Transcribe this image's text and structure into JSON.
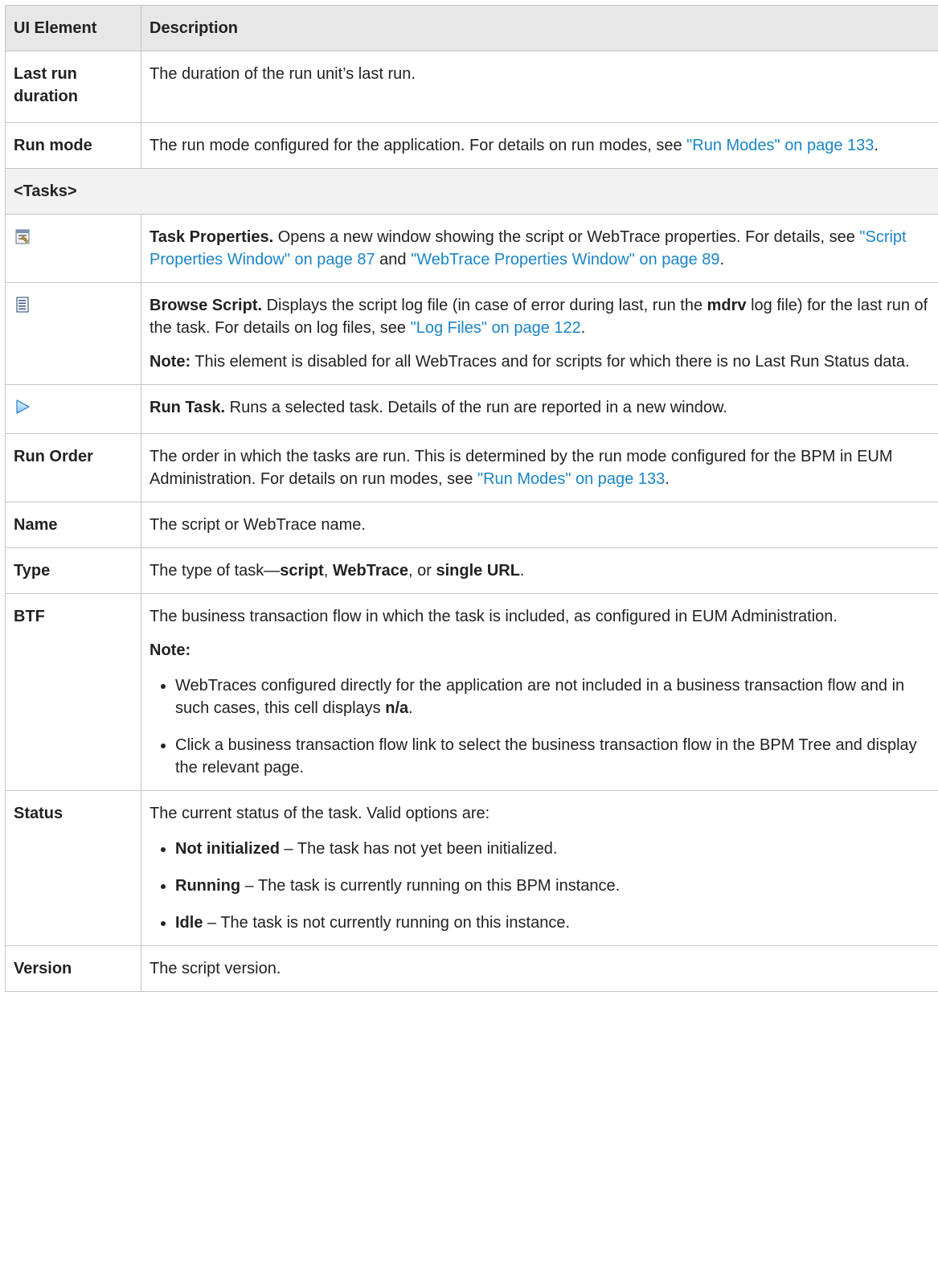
{
  "header": {
    "col1": "UI Element",
    "col2": "Description"
  },
  "rows": {
    "last_run": {
      "label": "Last run duration",
      "desc": "The duration of the run unit’s last run."
    },
    "run_mode": {
      "label": "Run mode",
      "desc_pre": "The run mode configured for the application. For details on run modes, see ",
      "link": "\"Run Modes\" on page 133",
      "desc_post": "."
    },
    "tasks_section": {
      "label": "<Tasks>"
    },
    "task_props": {
      "icon": "task-properties-icon",
      "title": "Task Properties.",
      "desc_pre": " Opens a new window showing the script or WebTrace properties. For details, see ",
      "link1": "\"Script Properties Window\" on page 87",
      "mid": " and ",
      "link2": "\"WebTrace Properties Window\" on page 89",
      "desc_post": "."
    },
    "browse_script": {
      "icon": "browse-script-icon",
      "title": "Browse Script.",
      "desc_pre": " Displays the script log file (in case of error during last, run the ",
      "bold": "mdrv",
      "desc_mid": " log file) for the last run of the task. For details on log files, see ",
      "link": "\"Log Files\" on page 122",
      "desc_post": ".",
      "note_label": "Note:",
      "note_text": " This element is disabled for all WebTraces and for scripts for which there is no Last Run Status data."
    },
    "run_task": {
      "icon": "run-task-icon",
      "title": "Run Task.",
      "desc": " Runs a selected task. Details of the run are reported in a new window."
    },
    "run_order": {
      "label": "Run Order",
      "desc_pre": "The order in which the tasks are run. This is determined by the run mode configured for the BPM in EUM Administration. For details on run modes, see ",
      "link": "\"Run Modes\" on page 133",
      "desc_post": "."
    },
    "name": {
      "label": "Name",
      "desc": "The script or WebTrace name."
    },
    "type": {
      "label": "Type",
      "desc_pre": "The type of task—",
      "b1": "script",
      "sep1": ", ",
      "b2": "WebTrace",
      "sep2": ", or ",
      "b3": "single URL",
      "desc_post": "."
    },
    "btf": {
      "label": "BTF",
      "desc": "The business transaction flow in which the task is included, as configured in EUM Administration.",
      "note_label": "Note:",
      "bullet1_pre": "WebTraces configured directly for the application are not included in a business transaction flow and in such cases, this cell displays ",
      "bullet1_bold": "n/a",
      "bullet1_post": ".",
      "bullet2": "Click a business transaction flow link to select the business transaction flow in the BPM Tree and display the relevant page."
    },
    "status": {
      "label": "Status",
      "desc": "The current status of the task. Valid options are:",
      "opt1_bold": "Not initialized",
      "opt1_text": " – The task has not yet been initialized.",
      "opt2_bold": "Running",
      "opt2_text": " – The task is currently running on this BPM instance.",
      "opt3_bold": "Idle",
      "opt3_text": " – The task is not currently running on this instance."
    },
    "version": {
      "label": "Version",
      "desc": "The script version."
    }
  },
  "colors": {
    "link": "#1a85c8",
    "header_bg": "#e7e7e7",
    "section_bg": "#f2f2f2",
    "border": "#c4c4c4"
  }
}
